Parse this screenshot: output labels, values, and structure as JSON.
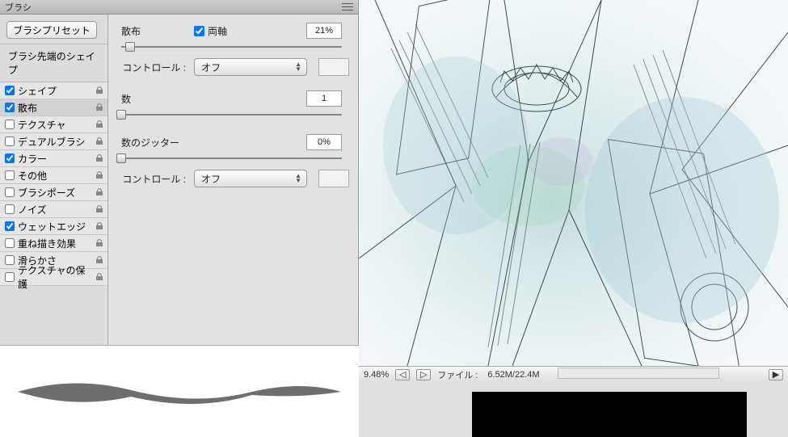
{
  "panel": {
    "title": "ブラシ",
    "preset_button": "ブラシプリセット",
    "tip_shape_title": "ブラシ先端のシェイプ",
    "options": [
      {
        "label": "シェイプ",
        "checked": true,
        "locked": true
      },
      {
        "label": "散布",
        "checked": true,
        "locked": true,
        "selected": true
      },
      {
        "label": "テクスチャ",
        "checked": false,
        "locked": true
      },
      {
        "label": "デュアルブラシ",
        "checked": false,
        "locked": true
      },
      {
        "label": "カラー",
        "checked": true,
        "locked": true
      },
      {
        "label": "その他",
        "checked": false,
        "locked": true
      },
      {
        "label": "ブラシポーズ",
        "checked": false,
        "locked": true
      },
      {
        "label": "ノイズ",
        "checked": false,
        "locked": true
      },
      {
        "label": "ウェットエッジ",
        "checked": true,
        "locked": true
      },
      {
        "label": "重ね描き効果",
        "checked": false,
        "locked": true
      },
      {
        "label": "滑らかさ",
        "checked": false,
        "locked": true
      },
      {
        "label": "テクスチャの保護",
        "checked": false,
        "locked": true
      }
    ]
  },
  "settings": {
    "scatter": {
      "label": "散布",
      "both_axes_label": "両軸",
      "both_axes_checked": true,
      "value": "21%",
      "slider_pct": 4
    },
    "control1": {
      "label": "コントロール :",
      "value": "オフ"
    },
    "count": {
      "label": "数",
      "value": "1",
      "slider_pct": 0
    },
    "jitter": {
      "label": "数のジッター",
      "value": "0%",
      "slider_pct": 0
    },
    "control2": {
      "label": "コントロール :",
      "value": "オフ"
    }
  },
  "status": {
    "zoom": "9.48%",
    "file_label": "ファイル :",
    "file_value": "6.52M/22.4M"
  }
}
